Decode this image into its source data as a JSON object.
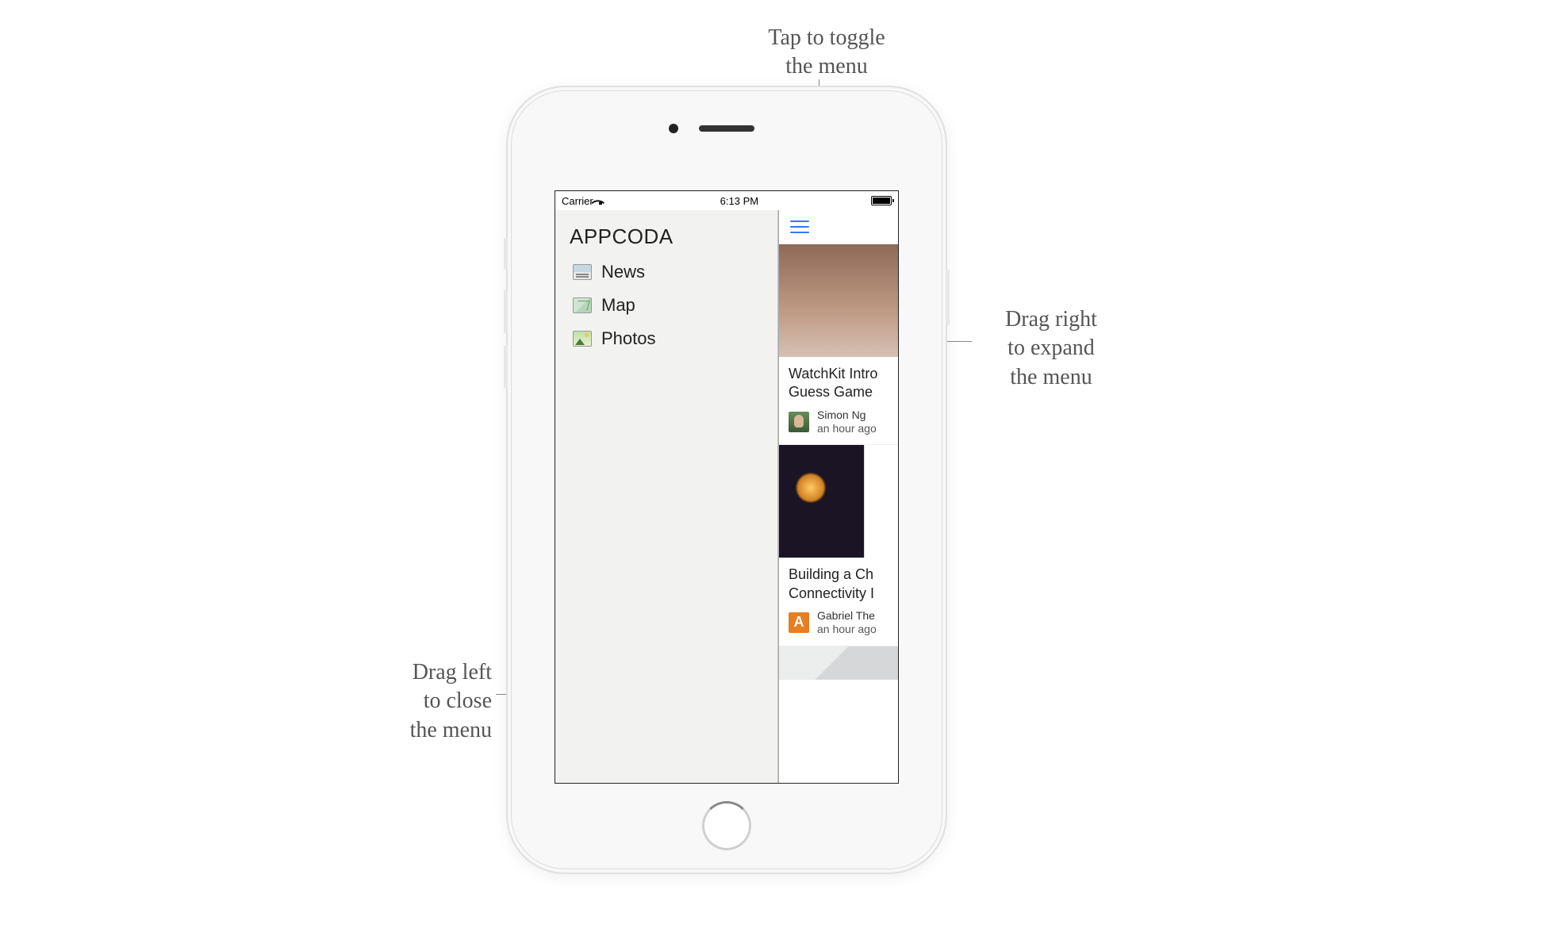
{
  "annotations": {
    "top": "Tap to toggle\nthe menu",
    "right": "Drag right\nto expand\nthe menu",
    "left": "Drag left\nto close\nthe menu"
  },
  "statusbar": {
    "carrier": "Carrier",
    "time": "6:13 PM"
  },
  "sidebar": {
    "title": "APPCODA",
    "items": [
      {
        "icon": "news",
        "label": "News"
      },
      {
        "icon": "map",
        "label": "Map"
      },
      {
        "icon": "photos",
        "label": "Photos"
      }
    ]
  },
  "feed": [
    {
      "title_line1": "WatchKit Intro",
      "title_line2": "Guess Game",
      "author": "Simon Ng",
      "time": "an hour ago"
    },
    {
      "title_line1": "Building a Ch",
      "title_line2": "Connectivity I",
      "author": "Gabriel The",
      "time": "an hour ago",
      "avatar_letter": "A"
    }
  ]
}
